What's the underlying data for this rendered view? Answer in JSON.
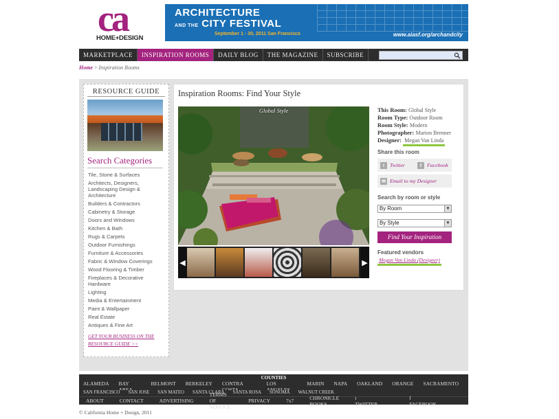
{
  "logo": {
    "mark": "ca",
    "sub": "HOME+DESIGN"
  },
  "banner": {
    "line1": "ARCHITECTURE",
    "line2_small": "AND THE",
    "line2": "CITY FESTIVAL",
    "dates": "September 1 - 30, 2011  San Francisco",
    "url": "www.aiasf.org/archandcity"
  },
  "nav": {
    "items": [
      "MARKETPLACE",
      "INSPIRATION ROOMS",
      "DAILY BLOG",
      "THE MAGAZINE",
      "SUBSCRIBE"
    ],
    "search_placeholder": ""
  },
  "breadcrumb": {
    "home": "Home",
    "sep": " > ",
    "current": "Inspiration Rooms"
  },
  "sidebar": {
    "resource_title": "RESOURCE GUIDE",
    "search_title": "Search Categories",
    "categories": [
      "Tile, Stone & Surfaces",
      "Architects, Designers, Landscaping Design & Architecture",
      "Builders & Contractors",
      "Cabinetry & Storage",
      "Doors and Windows",
      "Kitchen & Bath",
      "Rugs & Carpets",
      "Outdoor Furnishings",
      "Furniture & Accessories",
      "Fabric & Window Coverings",
      "Wood Flooring & Timber",
      "Fireplaces & Decorative Hardware",
      "Lighting",
      "Media & Entertainment",
      "Paint & Wallpaper",
      "Real Estate",
      "Antiques & Fine Art"
    ],
    "cta": "GET YOUR BUSINESS ON THE RESOURCE GUIDE >>"
  },
  "content": {
    "title": "Inspiration Rooms: Find Your Style",
    "hero_caption": "Global Style",
    "info": {
      "this_room_label": "This Room:",
      "this_room": "Global Style",
      "room_type_label": "Room Type:",
      "room_type": "Outdoor Room",
      "room_style_label": "Room Style:",
      "room_style": "Modern",
      "photographer_label": "Photographer:",
      "photographer": "Marion Brenner",
      "designer_label": "Designer:",
      "designer": "Megan Van Linda"
    },
    "share_title": "Share this room",
    "twitter": "Twitter",
    "facebook": "Facebook",
    "email": "Email to my Designer",
    "search_title": "Search by room or style",
    "by_room": "By Room",
    "by_style": "By Style",
    "find_btn": "Find Your Inspiration",
    "featured_title": "Featured vendors",
    "featured_vendor": "Megan Van Linda (Designer)"
  },
  "counties": {
    "title": "COUNTIES",
    "row1": [
      "ALAMEDA",
      "BAY AREA",
      "BELMONT",
      "BERKELEY",
      "CONTRA COSTA",
      "LOS ANGELES",
      "MARIN",
      "NAPA",
      "OAKLAND",
      "ORANGE",
      "SACRAMENTO"
    ],
    "row2": [
      "SAN FRANCISCO",
      "SAN JOSE",
      "SAN MATEO",
      "SANTA CLARA",
      "SANTA ROSA",
      "SONOMA",
      "WALNUT CREEK"
    ]
  },
  "footer": {
    "links": [
      "ABOUT",
      "CONTACT",
      "ADVERTISING",
      "TERMS OF SERVICE",
      "PRIVACY",
      "7x7",
      "CHRONICLE BOOKS",
      "TWITTER",
      "FACEBOOK"
    ],
    "copyright": "© California Home + Design, 2011"
  }
}
